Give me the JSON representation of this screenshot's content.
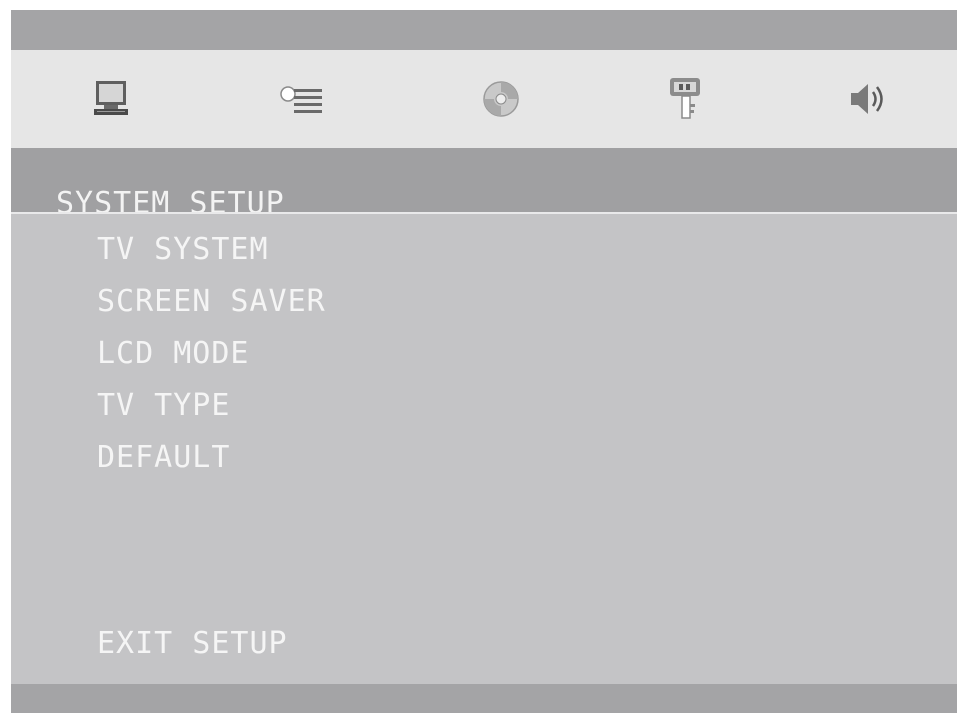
{
  "tabs": [
    {
      "icon": "monitor-icon"
    },
    {
      "icon": "language-list-icon"
    },
    {
      "icon": "disc-icon"
    },
    {
      "icon": "password-key-icon"
    },
    {
      "icon": "speaker-icon"
    }
  ],
  "section_title": "SYSTEM SETUP",
  "menu": {
    "items": [
      "TV SYSTEM",
      "SCREEN SAVER",
      "LCD MODE",
      "TV TYPE",
      "DEFAULT"
    ],
    "exit_label": "EXIT SETUP"
  }
}
